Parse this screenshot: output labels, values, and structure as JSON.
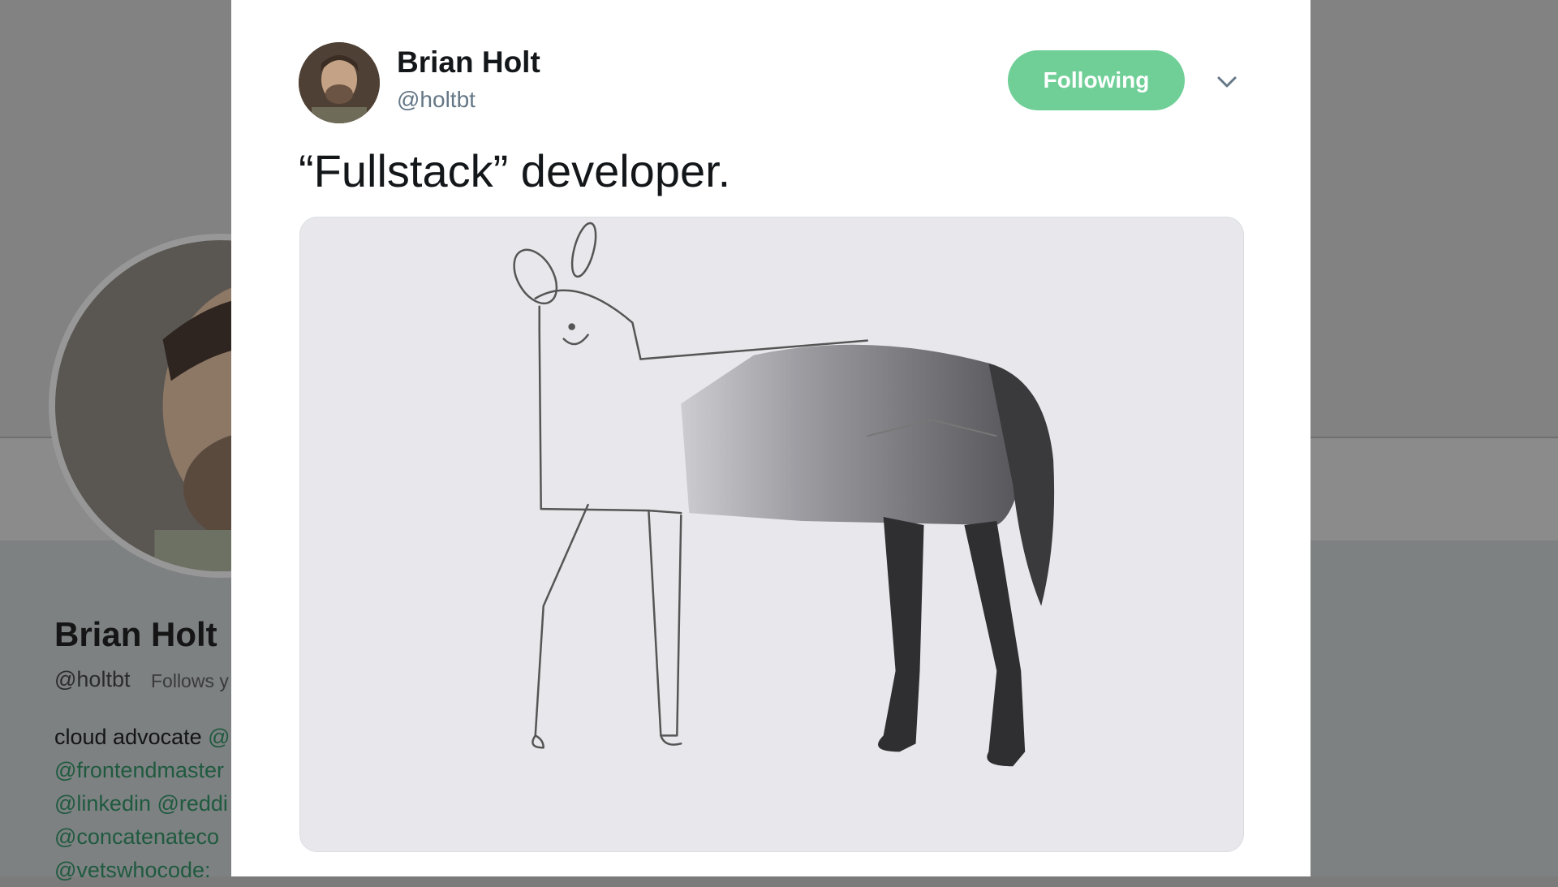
{
  "background_profile": {
    "name": "Brian Holt",
    "handle": "@holtbt",
    "follows_you": "Follows y",
    "bio_lines": [
      {
        "text": "cloud advocate ",
        "link": "@"
      },
      {
        "text": "",
        "link": "@frontendmaster"
      },
      {
        "text": "",
        "link": "@linkedin @reddi"
      },
      {
        "text": "",
        "link": "@concatenateco"
      },
      {
        "text": "",
        "link": "@vetswhocode: "
      }
    ]
  },
  "tweet": {
    "author_name": "Brian Holt",
    "author_handle": "@holtbt",
    "follow_button_label": "Following",
    "text": "“Fullstack” developer.",
    "media": {
      "icon": "horse-drawing-image",
      "description_visible": false
    }
  },
  "icons": {
    "caret": "chevron-down-icon",
    "avatar": "profile-photo"
  },
  "colors": {
    "following_button": "#6fcf97",
    "handle": "#657786",
    "text": "#14171a",
    "overlay": "#808080"
  }
}
